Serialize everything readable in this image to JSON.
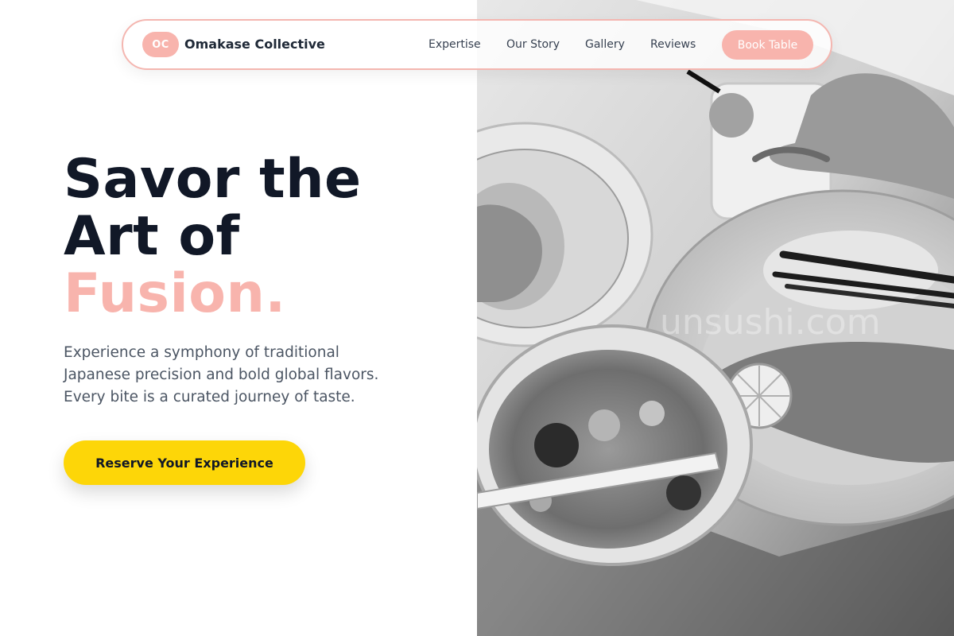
{
  "nav": {
    "logo_initials": "OC",
    "brand_name": "Omakase Collective",
    "links": [
      {
        "label": "Expertise"
      },
      {
        "label": "Our Story"
      },
      {
        "label": "Gallery"
      },
      {
        "label": "Reviews"
      }
    ],
    "cta_label": "Book Table"
  },
  "hero": {
    "headline_line1": "Savor the",
    "headline_line2": "Art of",
    "headline_accent": "Fusion.",
    "subtext_lines": [
      "Experience a symphony of traditional",
      "Japanese precision and bold global flavors.",
      "Every bite is a curated journey of taste."
    ],
    "cta_label": "Reserve Your Experience"
  },
  "photo": {
    "watermark": "unsushi.com"
  },
  "colors": {
    "accent_pink": "#f8b4ad",
    "cta_yellow": "#fdd608",
    "heading_dark": "#111827",
    "body_gray": "#4b5563"
  }
}
